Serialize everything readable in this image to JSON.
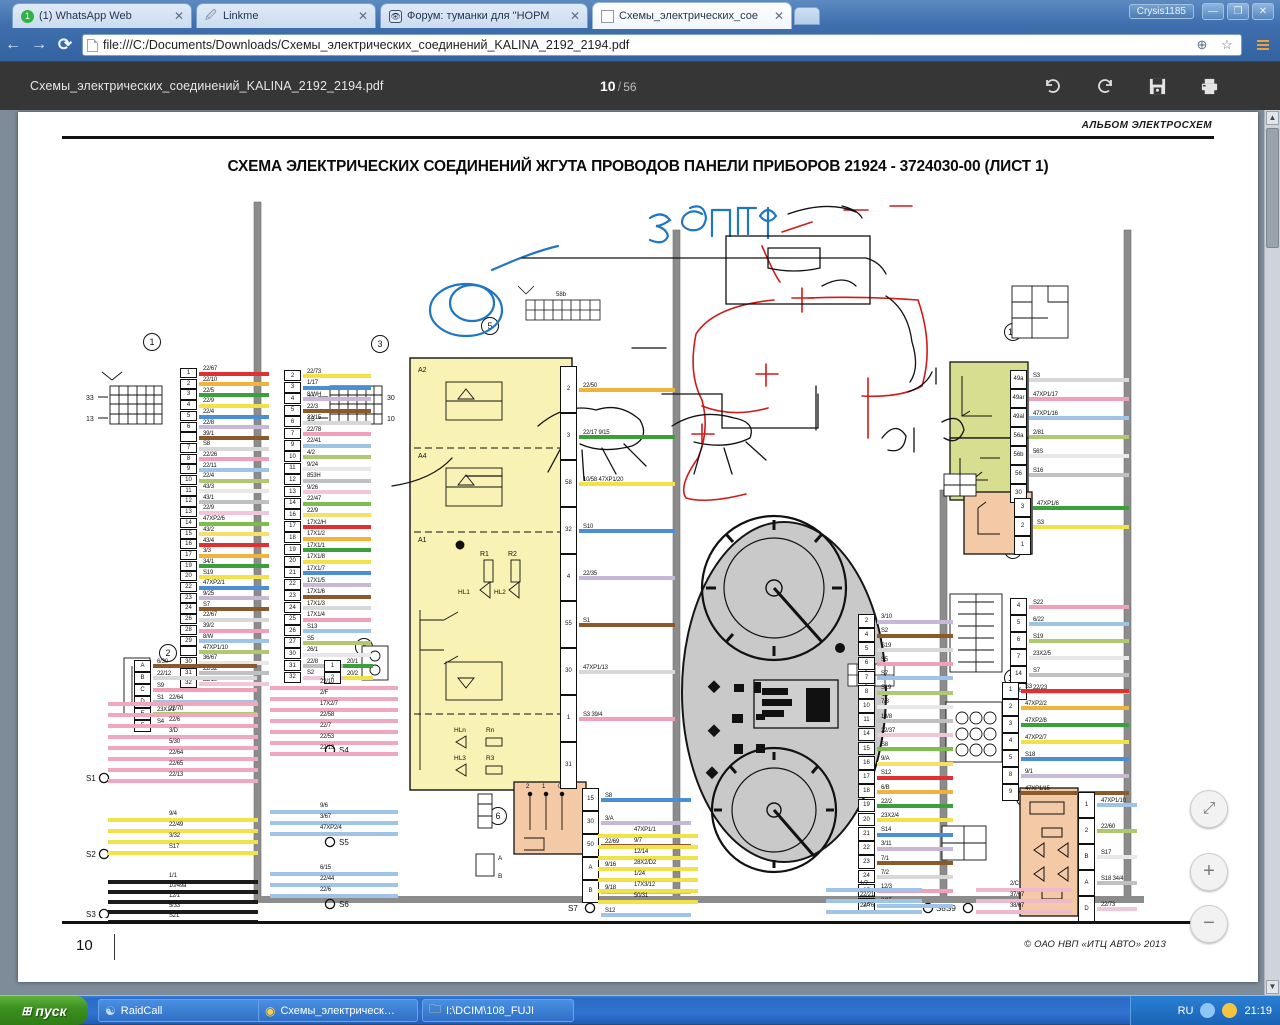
{
  "browser": {
    "tabs": [
      {
        "label": "(1) WhatsApp Web",
        "favicon": "whatsapp-icon",
        "active": false
      },
      {
        "label": "Linkme",
        "favicon": "link-icon",
        "active": false
      },
      {
        "label": "Форум: туманки для \"НОРМ",
        "favicon": "forum-icon",
        "active": false
      },
      {
        "label": "Схемы_электрических_сое",
        "favicon": "pdf-icon",
        "active": true
      }
    ],
    "close_glyph": "✕",
    "new_tab_label": "",
    "user_chip": "Crysis1185",
    "window_buttons": [
      "—",
      "❐",
      "✕"
    ],
    "nav": {
      "back": "←",
      "forward": "→",
      "reload": "⟳"
    },
    "url": "file:///C:/Documents/Downloads/Схемы_электрических_соединений_KALINA_2192_2194.pdf",
    "url_icons": {
      "zoom": "⊕",
      "bookmark": "☆",
      "menu": "menu-icon"
    }
  },
  "pdf_viewer": {
    "filename": "Схемы_электрических_соединений_KALINA_2192_2194.pdf",
    "page_current": "10",
    "page_separator": "/",
    "page_total": "56",
    "tools": [
      {
        "name": "rotate-cw-icon",
        "glyph": "↻"
      },
      {
        "name": "rotate-ccw-icon",
        "glyph": "↺"
      },
      {
        "name": "save-icon",
        "glyph": "💾"
      },
      {
        "name": "print-icon",
        "glyph": "🖶"
      }
    ],
    "zoom_controls": [
      {
        "name": "fit-page-button",
        "glyph": "⤢"
      },
      {
        "name": "zoom-in-button",
        "glyph": "+"
      },
      {
        "name": "zoom-out-button",
        "glyph": "−"
      }
    ]
  },
  "document": {
    "header_right": "АЛЬБОМ ЭЛЕКТРОСХЕМ",
    "title": "СХЕМА ЭЛЕКТРИЧЕСКИХ СОЕДИНЕНИЙ ЖГУТА ПРОВОДОВ ПАНЕЛИ ПРИБОРОВ 21924 - 3724030-00 (ЛИСТ 1)",
    "page_number": "10",
    "copyright": "©    ОАО НВП «ИТЦ АВТО»    2013"
  },
  "diagram": {
    "reference_markers": [
      "1",
      "2",
      "3",
      "4",
      "5",
      "6",
      "10",
      "11",
      "12",
      "13",
      "14"
    ],
    "block_labels": [
      "A2",
      "A4",
      "A1"
    ],
    "component_labels": [
      "R1",
      "R2",
      "R3",
      "Rn",
      "HL1",
      "HL2",
      "HL3",
      "HLn"
    ],
    "ground_points": [
      "S1",
      "S2",
      "S3",
      "S4",
      "S5",
      "S6",
      "S7",
      "S8",
      "S9"
    ],
    "connector_left_a": {
      "pins": [
        "1",
        "2",
        "3",
        "4",
        "5",
        "6",
        "",
        "7",
        "8",
        "9",
        "10",
        "11",
        "12",
        "13",
        "14",
        "15",
        "16",
        "17",
        "19",
        "20",
        "22",
        "23",
        "24",
        "26",
        "28",
        "29",
        "",
        "30",
        "31",
        "32"
      ],
      "wires": [
        "22/67",
        "22/10",
        "22/5",
        "22/9",
        "22/4",
        "22/8",
        "39/1",
        "S8",
        "22/26",
        "22/11",
        "22/4",
        "43/3",
        "43/1",
        "22/9",
        "47ХР2/6",
        "43/2",
        "43/4",
        "3/3",
        "34/1",
        "S19",
        "47ХР2/1",
        "9/25",
        "S7",
        "22/67",
        "39/2",
        "8/W",
        "47ХР1/10",
        "36/67",
        "22/32",
        "22/19"
      ]
    },
    "connector_left_b": {
      "pins": [
        "2",
        "3",
        "4",
        "5",
        "6",
        "7",
        "9",
        "10",
        "11",
        "12",
        "13",
        "14",
        "16",
        "17",
        "18",
        "19",
        "20",
        "21",
        "22",
        "23",
        "24",
        "25",
        "26",
        "27",
        "30",
        "31",
        "32"
      ],
      "wires": [
        "22/73",
        "1/17",
        "8/WH",
        "22/3",
        "22/15",
        "22/78",
        "22/41",
        "4/2",
        "9/24",
        "853Н",
        "9/26",
        "22/47",
        "22/9",
        "17Х2/Н",
        "17Х1/2",
        "17Х1/1",
        "17Х1/8",
        "17Х1/7",
        "17Х1/5",
        "17Х1/6",
        "17Х1/3",
        "17Х1/4",
        "S13",
        "S5",
        "26/1",
        "22/8",
        "S2"
      ]
    },
    "connector_2": {
      "pins": [
        "A",
        "B",
        "C",
        "D",
        "E",
        "F"
      ],
      "wires": [
        "6/30",
        "22/12",
        "S9",
        "S1",
        "23Х1/1",
        "S4"
      ]
    },
    "connector_3_out": {
      "pins": [
        "1",
        "2"
      ],
      "wires": [
        "20/1",
        "20/2"
      ]
    },
    "block5_outputs": {
      "pins": [
        "2",
        "3",
        "58",
        "32",
        "4",
        "55",
        "30",
        "1",
        "31"
      ],
      "wires": [
        "22/50",
        "22/17 9/15",
        "10/58 47ХР1/20",
        "S10",
        "22/35",
        "S1",
        "47ХР1/13",
        "S3 39/4"
      ]
    },
    "block6_outputs": {
      "pins": [
        "15",
        "30",
        "50",
        "A",
        "B"
      ],
      "wires": [
        "S8",
        "3/A",
        "22/69",
        "9/16",
        "9/18",
        "S12"
      ]
    },
    "cluster_connector": {
      "pins": [
        "2",
        "4",
        "5",
        "6",
        "7",
        "8",
        "10",
        "11",
        "14",
        "15",
        "16",
        "17",
        "18",
        "19",
        "20",
        "21",
        "22",
        "23",
        "24",
        "25",
        "26"
      ],
      "wires": [
        "3/10",
        "S2",
        "S19",
        "S5",
        "S7",
        "S19",
        "7/3",
        "13/8",
        "22/37",
        "S8",
        "9/A",
        "S12",
        "6/B",
        "22/2",
        "23Х2/4",
        "S14",
        "3/11",
        "7/1",
        "7/2",
        "12/3",
        "3/15"
      ]
    },
    "connector_10": {
      "pins": [
        "49a",
        "49ar",
        "49al",
        "56a",
        "56b",
        "56",
        "30"
      ],
      "wires": [
        "S3",
        "47ХР1/17",
        "47ХР1/16",
        "2/81",
        "56S",
        "S16"
      ]
    },
    "connector_11": {
      "pins": [
        "3",
        "2",
        "1"
      ],
      "wires": [
        "47ХР1/6",
        "S3"
      ]
    },
    "connector_12": {
      "pins": [
        "4",
        "5",
        "6",
        "7",
        "14",
        "16"
      ],
      "wires": [
        "S22",
        "6/22",
        "S19",
        "23Х2/5",
        "S7",
        "22/23"
      ]
    },
    "connector_13": {
      "pins": [
        "1",
        "2",
        "3",
        "4",
        "5",
        "8",
        "9"
      ],
      "wires": [
        "S3",
        "47ХР2/2",
        "47ХР2/8",
        "47ХР2/7",
        "S18",
        "9/1",
        "47ХР1/15"
      ]
    },
    "connector_14": {
      "pins": [
        "1",
        "2",
        "B",
        "A",
        "D"
      ],
      "wires": [
        "47ХР1/10",
        "22/60",
        "S17",
        "S18 34/4",
        "22/73"
      ]
    },
    "bundle_s1": [
      "22/64",
      "22/70",
      "22/6",
      "3/D",
      "5/30",
      "22/64",
      "22/65",
      "22/13"
    ],
    "bundle_s4": [
      "22/10",
      "2/F",
      "17Х2/7",
      "22/58",
      "22/7",
      "22/53",
      "22/13"
    ],
    "bundle_s2": [
      "9/4",
      "22/49",
      "3/32",
      "S17"
    ],
    "bundle_s5": [
      "9/6",
      "3/67",
      "47ХР2/4"
    ],
    "bundle_s3": [
      "1/1",
      "10/49a",
      "12/1",
      "5/33",
      "S21"
    ],
    "bundle_s6": [
      "6/15",
      "22/44",
      "22/6"
    ],
    "bundle_s7": [
      "47ХР1/1",
      "9/7",
      "12/14",
      "28Х2/D2",
      "1/24",
      "17Х3/12",
      "50/31"
    ],
    "bundle_s8": [
      "1/7",
      "22/21",
      "22/76"
    ],
    "bundle_s9": [
      "2/C",
      "37/67",
      "38/67"
    ],
    "handwriting": {
      "blue_text": "ЗДНТФ",
      "colors": {
        "blue": "#1f77c4",
        "red": "#d11a1a",
        "black": "#111111"
      }
    }
  },
  "taskbar": {
    "start_label": "пуск",
    "buttons": [
      {
        "label": "RaidCall",
        "icon": "raidcall-icon"
      },
      {
        "label": "Схемы_электрическ…",
        "icon": "chrome-icon"
      },
      {
        "label": "I:\\DCIM\\108_FUJI",
        "icon": "folder-icon"
      }
    ],
    "tray": {
      "language": "RU",
      "clock": "21:19"
    }
  },
  "colors": {
    "accent_blue": "#3f6fae",
    "pdf_bar": "#363636",
    "page_bg": "#7e8b99",
    "start_green": "#3b8f1f"
  }
}
